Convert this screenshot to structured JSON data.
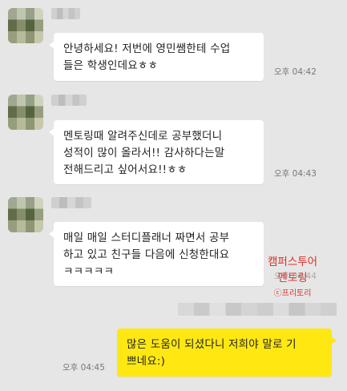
{
  "messages": [
    {
      "lines": [
        "안녕하세요! 저번에 영민쌤한테 수업",
        "들은 학생인데요ㅎㅎ"
      ],
      "time": "오후 04:42"
    },
    {
      "lines": [
        "멘토링때 알려주신데로 공부했더니",
        "성적이 많이 올라서!! 감사하다는말",
        "전해드리고 싶어서요!!ㅎㅎ"
      ],
      "time": "오후 04:43"
    },
    {
      "lines": [
        "매일 매일 스터디플래너 짜면서 공부",
        "하고 있고 친구들 다음에 신청한대요",
        "ㅋㅋㅋㅋㅋ"
      ],
      "time": "오후 04:44"
    }
  ],
  "reply": {
    "lines": [
      "많은 도움이 되셨다니 저희야 말로 기",
      "쁘네요:)"
    ],
    "time": "오후 04:45"
  },
  "watermark": {
    "line1": "캠퍼스투어",
    "line2": "멘토링",
    "line3": "ⓒ프리토리"
  }
}
